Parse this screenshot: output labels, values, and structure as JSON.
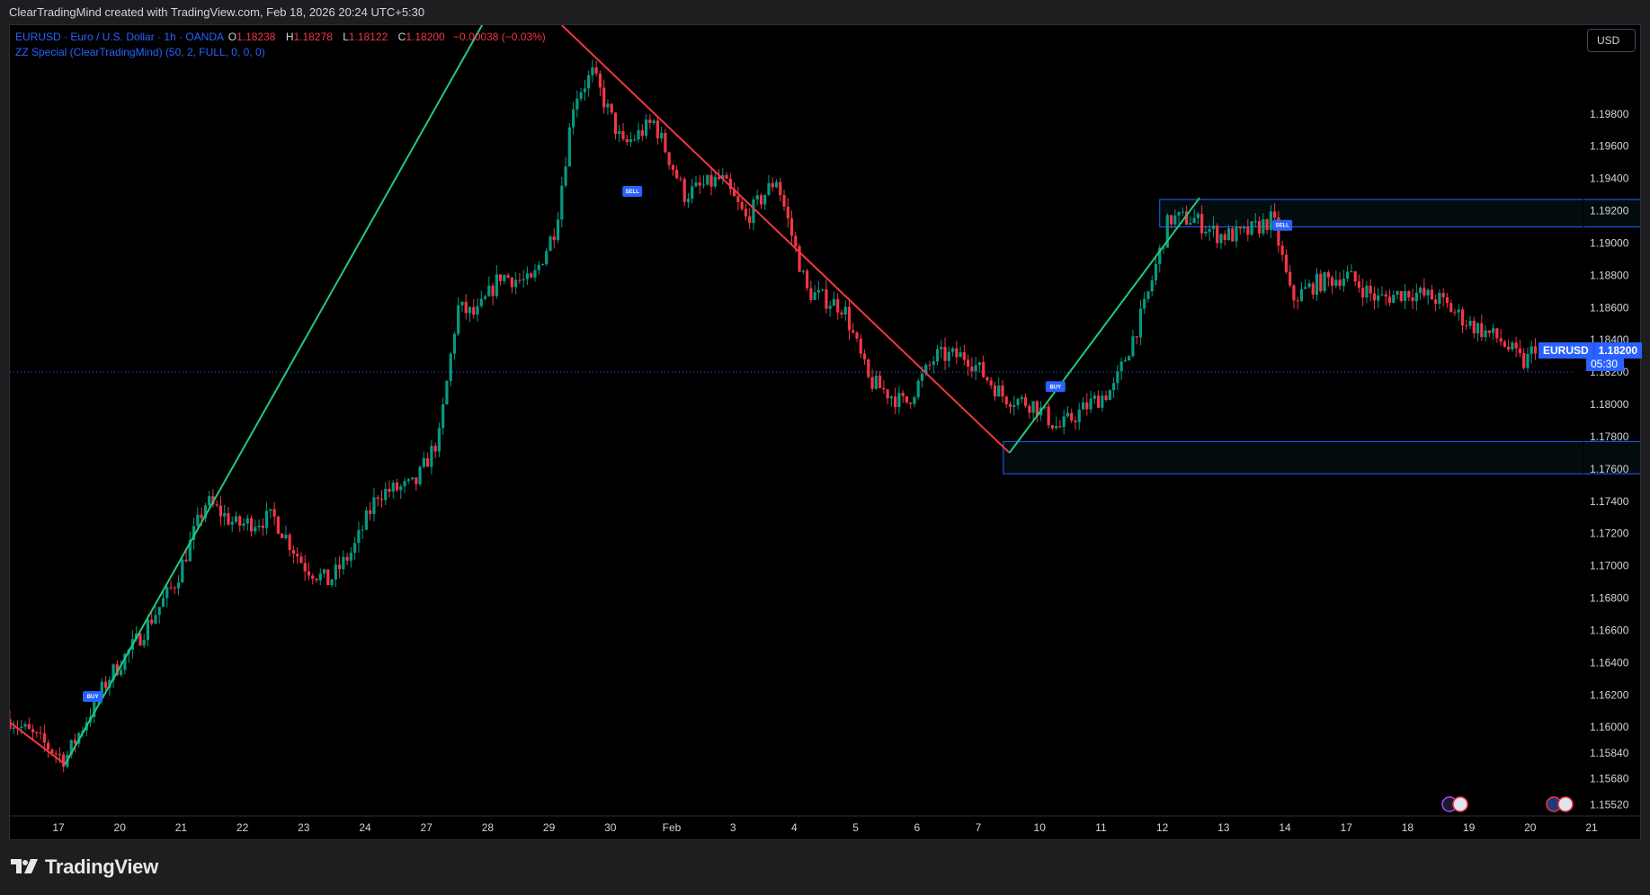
{
  "header": {
    "caption": "ClearTradingMind created with TradingView.com, Feb 18, 2026 20:24 UTC+5:30"
  },
  "legend": {
    "symbol_line": "EURUSD · Euro / U.S. Dollar · 1h · OANDA",
    "open_label": "O",
    "open_value": "1.18238",
    "high_label": "H",
    "high_value": "1.18278",
    "low_label": "L",
    "low_value": "1.18122",
    "close_label": "C",
    "close_value": "1.18200",
    "change": "−0.00038 (−0.03%)",
    "indicator": "ZZ Special (ClearTradingMind) (50, 2, FULL, 0, 0, 0)"
  },
  "toolbar": {
    "currency_label": "USD"
  },
  "price_badge": {
    "symbol": "EURUSD",
    "price": "1.18200",
    "countdown": "05:30"
  },
  "brand": {
    "name": "TradingView"
  },
  "colors": {
    "up": "#089981",
    "down": "#f23645",
    "zigzag_up": "#22c97a",
    "zigzag_down": "#f23645",
    "accent": "#2962ff",
    "zone_border": "#2962ff",
    "background": "#000000"
  },
  "chart_data": {
    "type": "candlestick",
    "symbol": "EURUSD",
    "timeframe": "1h",
    "ylim": [
      1.1545,
      1.2035
    ],
    "y_ticks": [
      "1.19800",
      "1.19600",
      "1.19400",
      "1.19200",
      "1.19000",
      "1.18800",
      "1.18600",
      "1.18400",
      "1.18200",
      "1.18000",
      "1.17800",
      "1.17600",
      "1.17400",
      "1.17200",
      "1.17000",
      "1.16800",
      "1.16600",
      "1.16400",
      "1.16200",
      "1.16000",
      "1.15840",
      "1.15680",
      "1.15520"
    ],
    "x_ticks": [
      "17",
      "20",
      "21",
      "22",
      "23",
      "24",
      "27",
      "28",
      "29",
      "30",
      "Feb",
      "3",
      "4",
      "5",
      "6",
      "7",
      "10",
      "11",
      "12",
      "13",
      "14",
      "17",
      "18",
      "19",
      "20",
      "21"
    ],
    "price_line": 1.182,
    "anchors": [
      {
        "t": 0.0,
        "p": 1.1605
      },
      {
        "t": 0.9,
        "p": 1.158
      },
      {
        "t": 1.6,
        "p": 1.163
      },
      {
        "t": 2.1,
        "p": 1.1655
      },
      {
        "t": 2.7,
        "p": 1.169
      },
      {
        "t": 3.2,
        "p": 1.174
      },
      {
        "t": 3.7,
        "p": 1.1725
      },
      {
        "t": 4.3,
        "p": 1.173
      },
      {
        "t": 4.8,
        "p": 1.17
      },
      {
        "t": 5.2,
        "p": 1.169
      },
      {
        "t": 5.6,
        "p": 1.171
      },
      {
        "t": 6.0,
        "p": 1.1745
      },
      {
        "t": 6.6,
        "p": 1.175
      },
      {
        "t": 7.0,
        "p": 1.178
      },
      {
        "t": 7.3,
        "p": 1.186
      },
      {
        "t": 7.6,
        "p": 1.1855
      },
      {
        "t": 8.0,
        "p": 1.188
      },
      {
        "t": 8.5,
        "p": 1.1875
      },
      {
        "t": 8.9,
        "p": 1.191
      },
      {
        "t": 9.2,
        "p": 1.199
      },
      {
        "t": 9.5,
        "p": 1.2005
      },
      {
        "t": 10.0,
        "p": 1.196
      },
      {
        "t": 10.5,
        "p": 1.1975
      },
      {
        "t": 11.0,
        "p": 1.193
      },
      {
        "t": 11.6,
        "p": 1.194
      },
      {
        "t": 12.0,
        "p": 1.1915
      },
      {
        "t": 12.5,
        "p": 1.194
      },
      {
        "t": 13.0,
        "p": 1.187
      },
      {
        "t": 13.6,
        "p": 1.186
      },
      {
        "t": 14.0,
        "p": 1.1815
      },
      {
        "t": 14.6,
        "p": 1.18
      },
      {
        "t": 15.1,
        "p": 1.183
      },
      {
        "t": 15.6,
        "p": 1.183
      },
      {
        "t": 16.2,
        "p": 1.1805
      },
      {
        "t": 16.7,
        "p": 1.18
      },
      {
        "t": 17.1,
        "p": 1.1785
      },
      {
        "t": 17.6,
        "p": 1.18
      },
      {
        "t": 18.0,
        "p": 1.181
      },
      {
        "t": 18.5,
        "p": 1.186
      },
      {
        "t": 18.9,
        "p": 1.1915
      },
      {
        "t": 19.3,
        "p": 1.1915
      },
      {
        "t": 19.7,
        "p": 1.1905
      },
      {
        "t": 20.1,
        "p": 1.1905
      },
      {
        "t": 20.6,
        "p": 1.1915
      },
      {
        "t": 20.9,
        "p": 1.1865
      },
      {
        "t": 21.3,
        "p": 1.1875
      },
      {
        "t": 21.8,
        "p": 1.188
      },
      {
        "t": 22.3,
        "p": 1.1865
      },
      {
        "t": 22.8,
        "p": 1.187
      },
      {
        "t": 23.3,
        "p": 1.1865
      },
      {
        "t": 23.8,
        "p": 1.185
      },
      {
        "t": 24.3,
        "p": 1.184
      },
      {
        "t": 24.7,
        "p": 1.1825
      },
      {
        "t": 25.0,
        "p": 1.1845
      },
      {
        "t": 25.4,
        "p": 1.183
      },
      {
        "t": 25.7,
        "p": 1.182
      }
    ],
    "zigzag": [
      {
        "t": 0.0,
        "p": 1.1603,
        "dir": "down"
      },
      {
        "t": 0.9,
        "p": 1.1577,
        "dir": "up"
      },
      {
        "t": 7.7,
        "p": 1.2035,
        "dir": "gap"
      },
      {
        "t": 9.0,
        "p": 1.2035,
        "dir": "down"
      },
      {
        "t": 16.3,
        "p": 1.177,
        "dir": "up"
      },
      {
        "t": 19.4,
        "p": 1.1928
      }
    ],
    "signals": [
      {
        "label": "BUY",
        "t": 1.35,
        "p": 1.1619
      },
      {
        "label": "SELL",
        "t": 10.15,
        "p": 1.1932
      },
      {
        "label": "BUY",
        "t": 17.05,
        "p": 1.1811
      },
      {
        "label": "SELL",
        "t": 20.75,
        "p": 1.1911
      }
    ],
    "zones": [
      {
        "name": "resistance",
        "t0": 18.75,
        "t1": 26.95,
        "p_top": 1.1927,
        "p_bottom": 1.191
      },
      {
        "name": "support",
        "t0": 16.2,
        "t1": 26.95,
        "p_top": 1.1777,
        "p_bottom": 1.1757
      }
    ]
  }
}
